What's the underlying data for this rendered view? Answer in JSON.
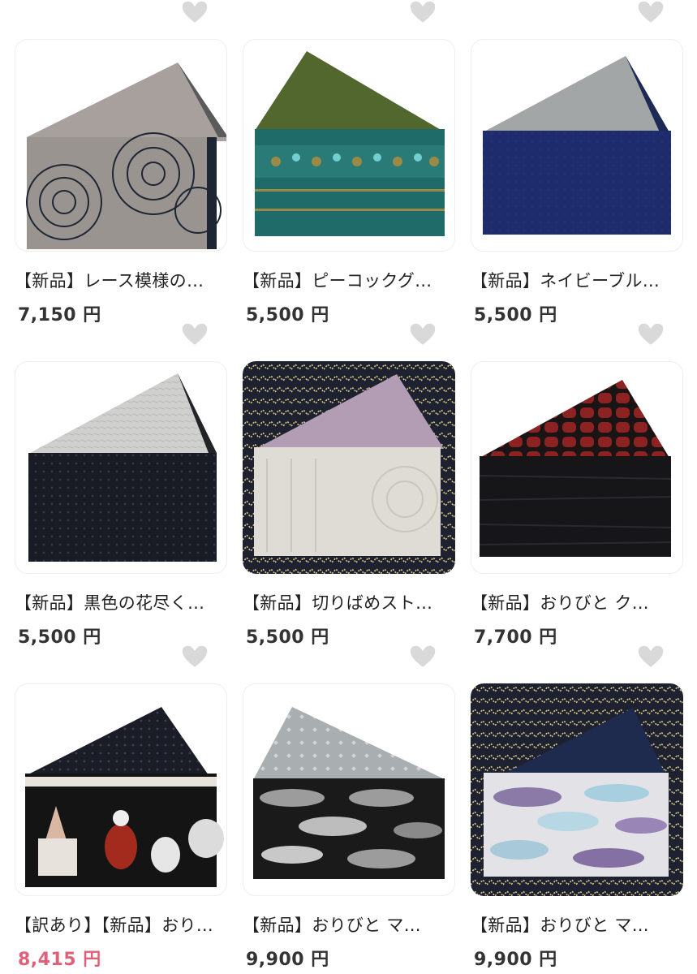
{
  "products": [
    {
      "title": "【新品】レース模様の…",
      "price": "7,150 円",
      "icon": "heart-outline-icon"
    },
    {
      "title": "【新品】ピーコックグ…",
      "price": "5,500 円",
      "icon": "heart-outline-icon"
    },
    {
      "title": "【新品】ネイビーブル…",
      "price": "5,500 円",
      "icon": "heart-outline-icon"
    },
    {
      "title": "【新品】黒色の花尽く…",
      "price": "5,500 円",
      "icon": "heart-outline-icon"
    },
    {
      "title": "【新品】切りばめスト…",
      "price": "5,500 円",
      "icon": "heart-outline-icon"
    },
    {
      "title": "【新品】おりびと ク…",
      "price": "7,700 円",
      "icon": "heart-outline-icon"
    },
    {
      "title": "【訳あり】【新品】おり…",
      "price": "8,415 円",
      "price_color": "#e0607a",
      "icon": "heart-outline-icon"
    },
    {
      "title": "【新品】おりびと マ…",
      "price": "9,900 円",
      "icon": "heart-outline-icon"
    },
    {
      "title": "【新品】おりびと マ…",
      "price": "9,900 円",
      "icon": "heart-outline-icon"
    }
  ]
}
